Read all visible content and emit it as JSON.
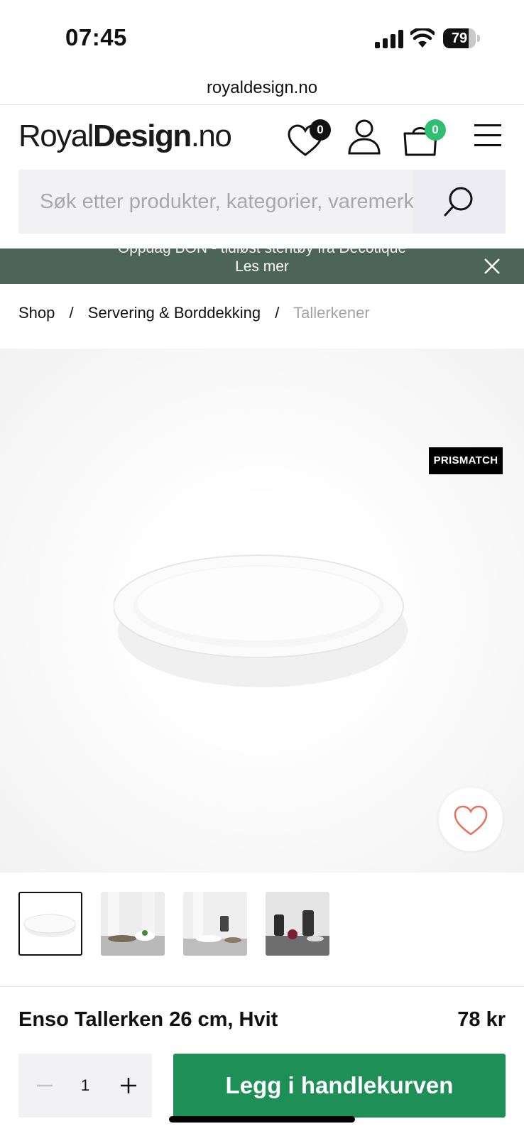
{
  "status_bar": {
    "time": "07:45",
    "battery_level": "79",
    "battery_fraction": 0.79
  },
  "browser": {
    "url": "royaldesign.no"
  },
  "header": {
    "logo_regular": "Royal",
    "logo_bold": "Design",
    "logo_suffix": ".no",
    "wishlist_count": "0",
    "cart_count": "0",
    "colors": {
      "badge_dark": "#111111",
      "badge_green": "#2fbf71"
    }
  },
  "search": {
    "placeholder": "Søk etter produkter, kategorier, varemerker"
  },
  "promo": {
    "text": "Oppdag BON - tidløst stentøy fra Decotique",
    "link": "Les mer",
    "background": "#4d6558"
  },
  "breadcrumb": {
    "items": [
      "Shop",
      "Servering & Borddekking",
      "Tallerkener"
    ],
    "separator": "/"
  },
  "product": {
    "badge": "PRISMATCH",
    "name": "Enso Tallerken 26 cm, Hvit",
    "price": "78 kr",
    "quantity": "1",
    "add_to_cart": "Legg i handlekurven",
    "thumbnail_count": 4
  },
  "icons": {
    "wishlist": "heart-icon",
    "account": "user-icon",
    "cart": "shopping-bag-icon",
    "menu": "hamburger-menu-icon",
    "search": "search-icon",
    "close": "close-icon",
    "favorite": "heart-outline-icon",
    "minus": "minus-icon",
    "plus": "plus-icon"
  },
  "colors": {
    "accent": "#1e8f57",
    "favorite_heart": "#e8705f"
  }
}
